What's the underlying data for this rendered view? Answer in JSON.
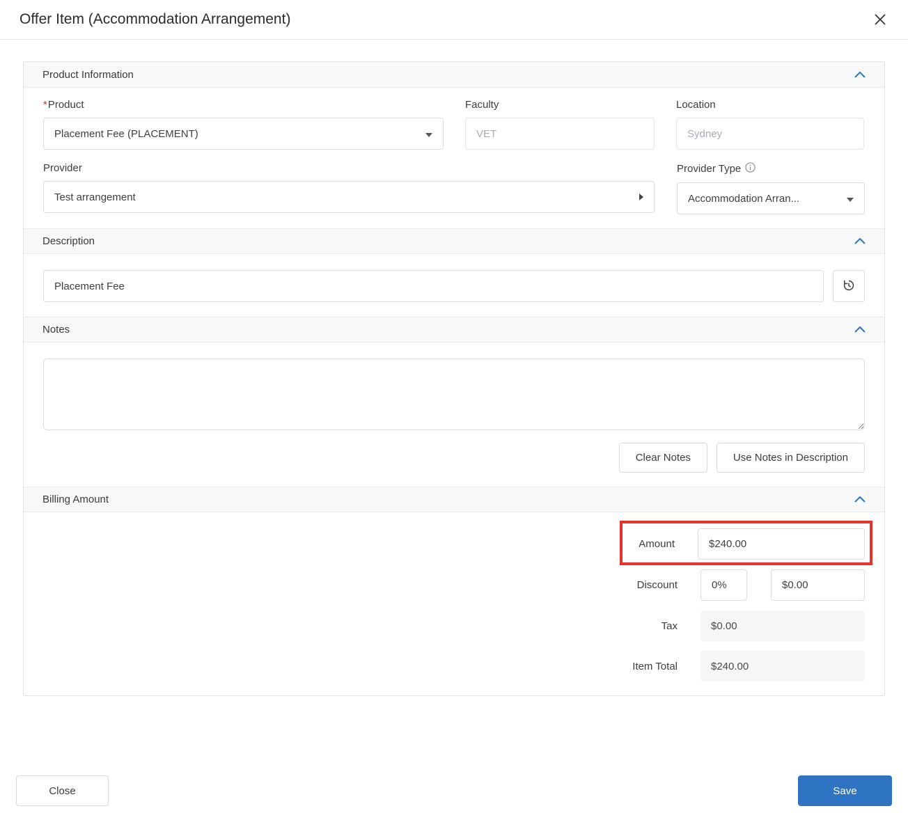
{
  "modal": {
    "title": "Offer Item (Accommodation Arrangement)"
  },
  "sections": {
    "product_info": {
      "title": "Product Information",
      "product": {
        "label": "Product",
        "required_marker": "*",
        "value": "Placement Fee (PLACEMENT)"
      },
      "faculty": {
        "label": "Faculty",
        "value": "VET"
      },
      "location": {
        "label": "Location",
        "value": "Sydney"
      },
      "provider": {
        "label": "Provider",
        "value": "Test arrangement"
      },
      "provider_type": {
        "label": "Provider Type",
        "value": "Accommodation Arran..."
      }
    },
    "description": {
      "title": "Description",
      "value": "Placement Fee"
    },
    "notes": {
      "title": "Notes",
      "value": "",
      "clear_button_label": "Clear Notes",
      "use_button_label": "Use Notes in Description"
    },
    "billing": {
      "title": "Billing Amount",
      "amount": {
        "label": "Amount",
        "value": "$240.00"
      },
      "discount": {
        "label": "Discount",
        "percent_value": "0%",
        "amount_value": "$0.00"
      },
      "tax": {
        "label": "Tax",
        "value": "$0.00"
      },
      "item_total": {
        "label": "Item Total",
        "value": "$240.00"
      }
    }
  },
  "footer": {
    "close_label": "Close",
    "save_label": "Save"
  },
  "colors": {
    "accent_blue": "#2e74c2",
    "highlight_red": "#e8312b",
    "section_header_bg": "#f7f8f9",
    "readonly_bg": "#f5f6f7"
  }
}
